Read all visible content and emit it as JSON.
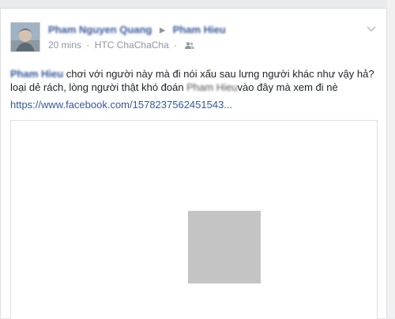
{
  "post": {
    "author_name": "Pham Nguyen Quang",
    "target_name": "Pham Hieu",
    "time": "20 mins",
    "separator": "·",
    "device": "HTC ChaChaCha",
    "privacy_icon": "friends-icon",
    "text_name": "Pham Hieu",
    "text_part1": " chơi với người này mà đi nói xấu sau lưng người khác như vậy hả? loại dẻ rách, lòng người thật khó đoán ",
    "text_hidden": "Pham Hieu",
    "text_part2": "vào đây mà xem đi nè",
    "link": "https://www.facebook.com/1578237562451543..."
  },
  "icons": {
    "options": "chevron-down-icon",
    "avatar": "profile-photo"
  }
}
